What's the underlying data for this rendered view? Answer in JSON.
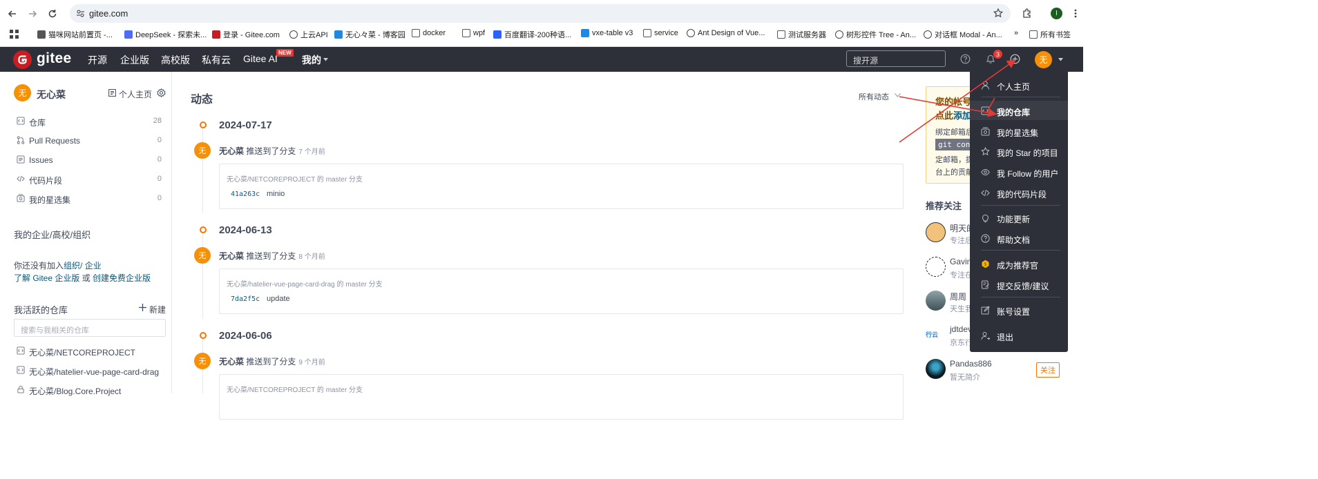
{
  "browser": {
    "url": "gitee.com",
    "profile_initial": "I",
    "bookmarks": [
      {
        "label": "猫咪网站前置页 -...",
        "icon": "cat-icon"
      },
      {
        "label": "DeepSeek - 探索未...",
        "icon": "deepseek-icon"
      },
      {
        "label": "登录 - Gitee.com",
        "icon": "gitee-icon"
      },
      {
        "label": "上云API",
        "icon": "globe-icon"
      },
      {
        "label": "无心々菜 - 博客园",
        "icon": "blog-icon"
      },
      {
        "label": "docker",
        "icon": "folder-icon"
      },
      {
        "label": "wpf",
        "icon": "folder-icon"
      },
      {
        "label": "百度翻译-200种语...",
        "icon": "translate-icon"
      },
      {
        "label": "vxe-table v3",
        "icon": "vxe-icon"
      },
      {
        "label": "service",
        "icon": "folder-icon"
      },
      {
        "label": "Ant Design of Vue...",
        "icon": "globe-icon"
      },
      {
        "label": "测试服务器",
        "icon": "folder-icon"
      },
      {
        "label": "树形控件 Tree - An...",
        "icon": "globe-icon"
      },
      {
        "label": "对话框 Modal - An...",
        "icon": "globe-icon"
      }
    ],
    "more_bookmarks": "»",
    "all_bookmarks": "所有书签"
  },
  "nav": {
    "logo": "gitee",
    "items": [
      "开源",
      "企业版",
      "高校版",
      "私有云",
      "Gitee AI"
    ],
    "new_badge": "NEW",
    "mine": "我的",
    "search_placeholder": "搜开源",
    "notification_count": "3",
    "avatar_char": "无"
  },
  "sidebar": {
    "user_name": "无心菜",
    "avatar_char": "无",
    "homepage": "个人主页",
    "menu": [
      {
        "label": "仓库",
        "count": "28",
        "icon": "repo-icon"
      },
      {
        "label": "Pull Requests",
        "count": "0",
        "icon": "pull-request-icon"
      },
      {
        "label": "Issues",
        "count": "0",
        "icon": "issue-icon"
      },
      {
        "label": "代码片段",
        "count": "0",
        "icon": "code-icon"
      },
      {
        "label": "我的星选集",
        "count": "0",
        "icon": "collection-icon"
      }
    ],
    "org_title": "我的企业/高校/组织",
    "org_text_1": "你还没有加入",
    "org_link_1": "组织",
    "org_sep": "/ ",
    "org_link_2": "企业",
    "org_text_2_link": "了解 Gitee 企业版",
    "org_text_or": " 或 ",
    "org_link_3": "创建免费企业版",
    "active_title": "我活跃的仓库",
    "new_label": "新建",
    "repo_search_placeholder": "搜索与我相关的仓库",
    "repos": [
      {
        "label": "无心菜/NETCOREPROJECT",
        "icon": "repo-icon"
      },
      {
        "label": "无心菜/hatelier-vue-page-card-drag",
        "icon": "repo-icon"
      },
      {
        "label": "无心菜/Blog.Core.Project",
        "icon": "lock-icon"
      }
    ]
  },
  "main": {
    "title": "动态",
    "filter": "所有动态",
    "events": [
      {
        "date": "2024-07-17",
        "user": "无心菜",
        "action": "推送到了分支",
        "time": "7 个月前",
        "repo": "无心菜/NETCOREPROJECT 的 master 分支",
        "sha": "41a263c",
        "msg": "minio"
      },
      {
        "date": "2024-06-13",
        "user": "无心菜",
        "action": "推送到了分支",
        "time": "8 个月前",
        "repo": "无心菜/hatelier-vue-page-card-drag 的 master 分支",
        "sha": "7da2f5c",
        "msg": "update"
      },
      {
        "date": "2024-06-06",
        "user": "无心菜",
        "action": "推送到了分支",
        "time": "9 个月前",
        "repo": "无心菜/NETCOREPROJECT 的 master 分支",
        "sha": "",
        "msg": ""
      }
    ]
  },
  "notice": {
    "line1": "您的帐号",
    "line2_a": "点此",
    "line2_link": "添加",
    "body1": "绑定邮箱后",
    "code": "git config",
    "body2": "定邮箱，提",
    "body3": "台上的贡献"
  },
  "recommend": {
    "title": "推荐关注",
    "users": [
      {
        "name": "明天的",
        "desc": "专注后",
        "icon": "avatar-cartoon-icon"
      },
      {
        "name": "Gavin",
        "desc": "专注在",
        "icon": "avatar-panda-icon"
      },
      {
        "name": "周周",
        "desc": "天生我",
        "icon": "avatar-photo-icon"
      },
      {
        "name": "jdtdev",
        "desc": "京东行",
        "icon": "jd-cloud-icon",
        "logo_text": "行云"
      },
      {
        "name": "Pandas886",
        "desc": "暂无简介",
        "icon": "avatar-dark-icon",
        "follow": "关注"
      }
    ]
  },
  "dropdown": {
    "items": [
      {
        "label": "个人主页",
        "icon": "user-icon"
      },
      {
        "label": "我的仓库",
        "icon": "repo-icon"
      },
      {
        "label": "我的星选集",
        "icon": "collection-icon"
      },
      {
        "label": "我的 Star 的项目",
        "icon": "star-icon"
      },
      {
        "label": "我 Follow 的用户",
        "icon": "eye-icon"
      },
      {
        "label": "我的代码片段",
        "icon": "code-icon"
      },
      {
        "label": "功能更新",
        "icon": "bulb-icon"
      },
      {
        "label": "帮助文档",
        "icon": "help-icon"
      },
      {
        "label": "成为推荐官",
        "icon": "coin-icon"
      },
      {
        "label": "提交反馈/建议",
        "icon": "feedback-icon"
      },
      {
        "label": "账号设置",
        "icon": "edit-icon"
      },
      {
        "label": "退出",
        "icon": "logout-icon"
      }
    ]
  },
  "colors": {
    "nav_bg": "#2d3039",
    "accent_orange": "#fe7300",
    "avatar_orange": "#f79009",
    "link_blue": "#005980",
    "annotation_red": "#e53935"
  }
}
